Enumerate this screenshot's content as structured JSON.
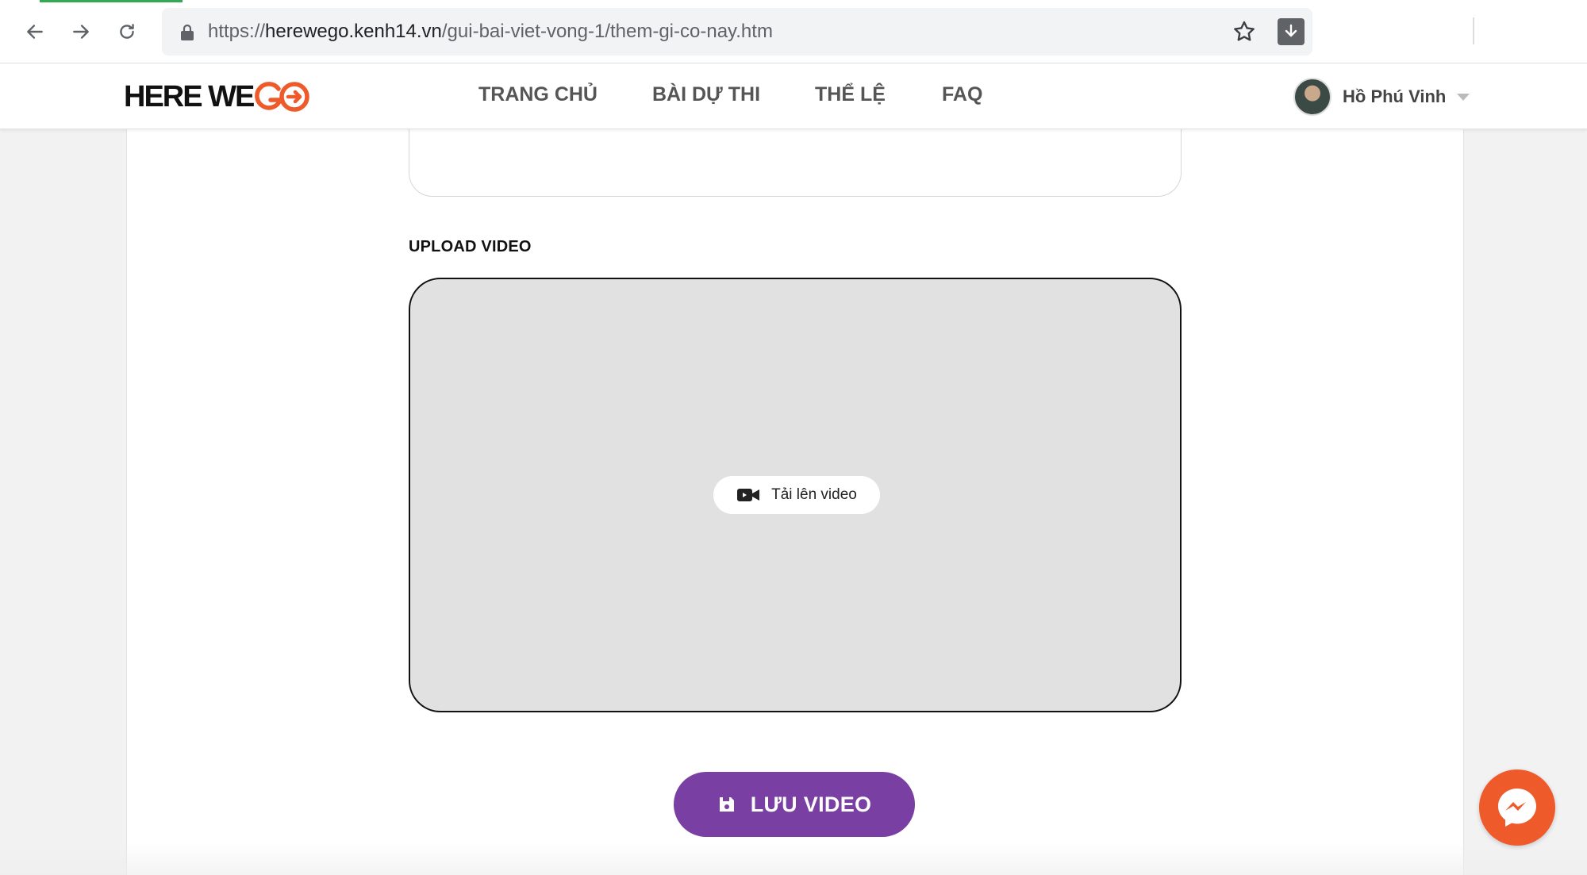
{
  "browser": {
    "url_scheme": "https://",
    "url_host": "herewego.kenh14.vn",
    "url_path": "/gui-bai-viet-vong-1/them-gi-co-nay.htm"
  },
  "header": {
    "logo_text": "HERE WE",
    "nav": [
      "TRANG CHỦ",
      "BÀI DỰ THI",
      "THỂ LỆ",
      "FAQ"
    ],
    "user_name": "Hồ Phú Vinh"
  },
  "form": {
    "upload_label": "UPLOAD VIDEO",
    "upload_button": "Tải lên video",
    "save_button": "LƯU VIDEO"
  },
  "colors": {
    "brand_orange": "#ef5a2a",
    "save_purple": "#7a3fa2"
  },
  "icons": [
    "back-icon",
    "forward-icon",
    "reload-icon",
    "lock-icon",
    "star-icon",
    "download-icon",
    "video-camera-icon",
    "save-icon",
    "messenger-icon",
    "chevron-down-icon"
  ]
}
